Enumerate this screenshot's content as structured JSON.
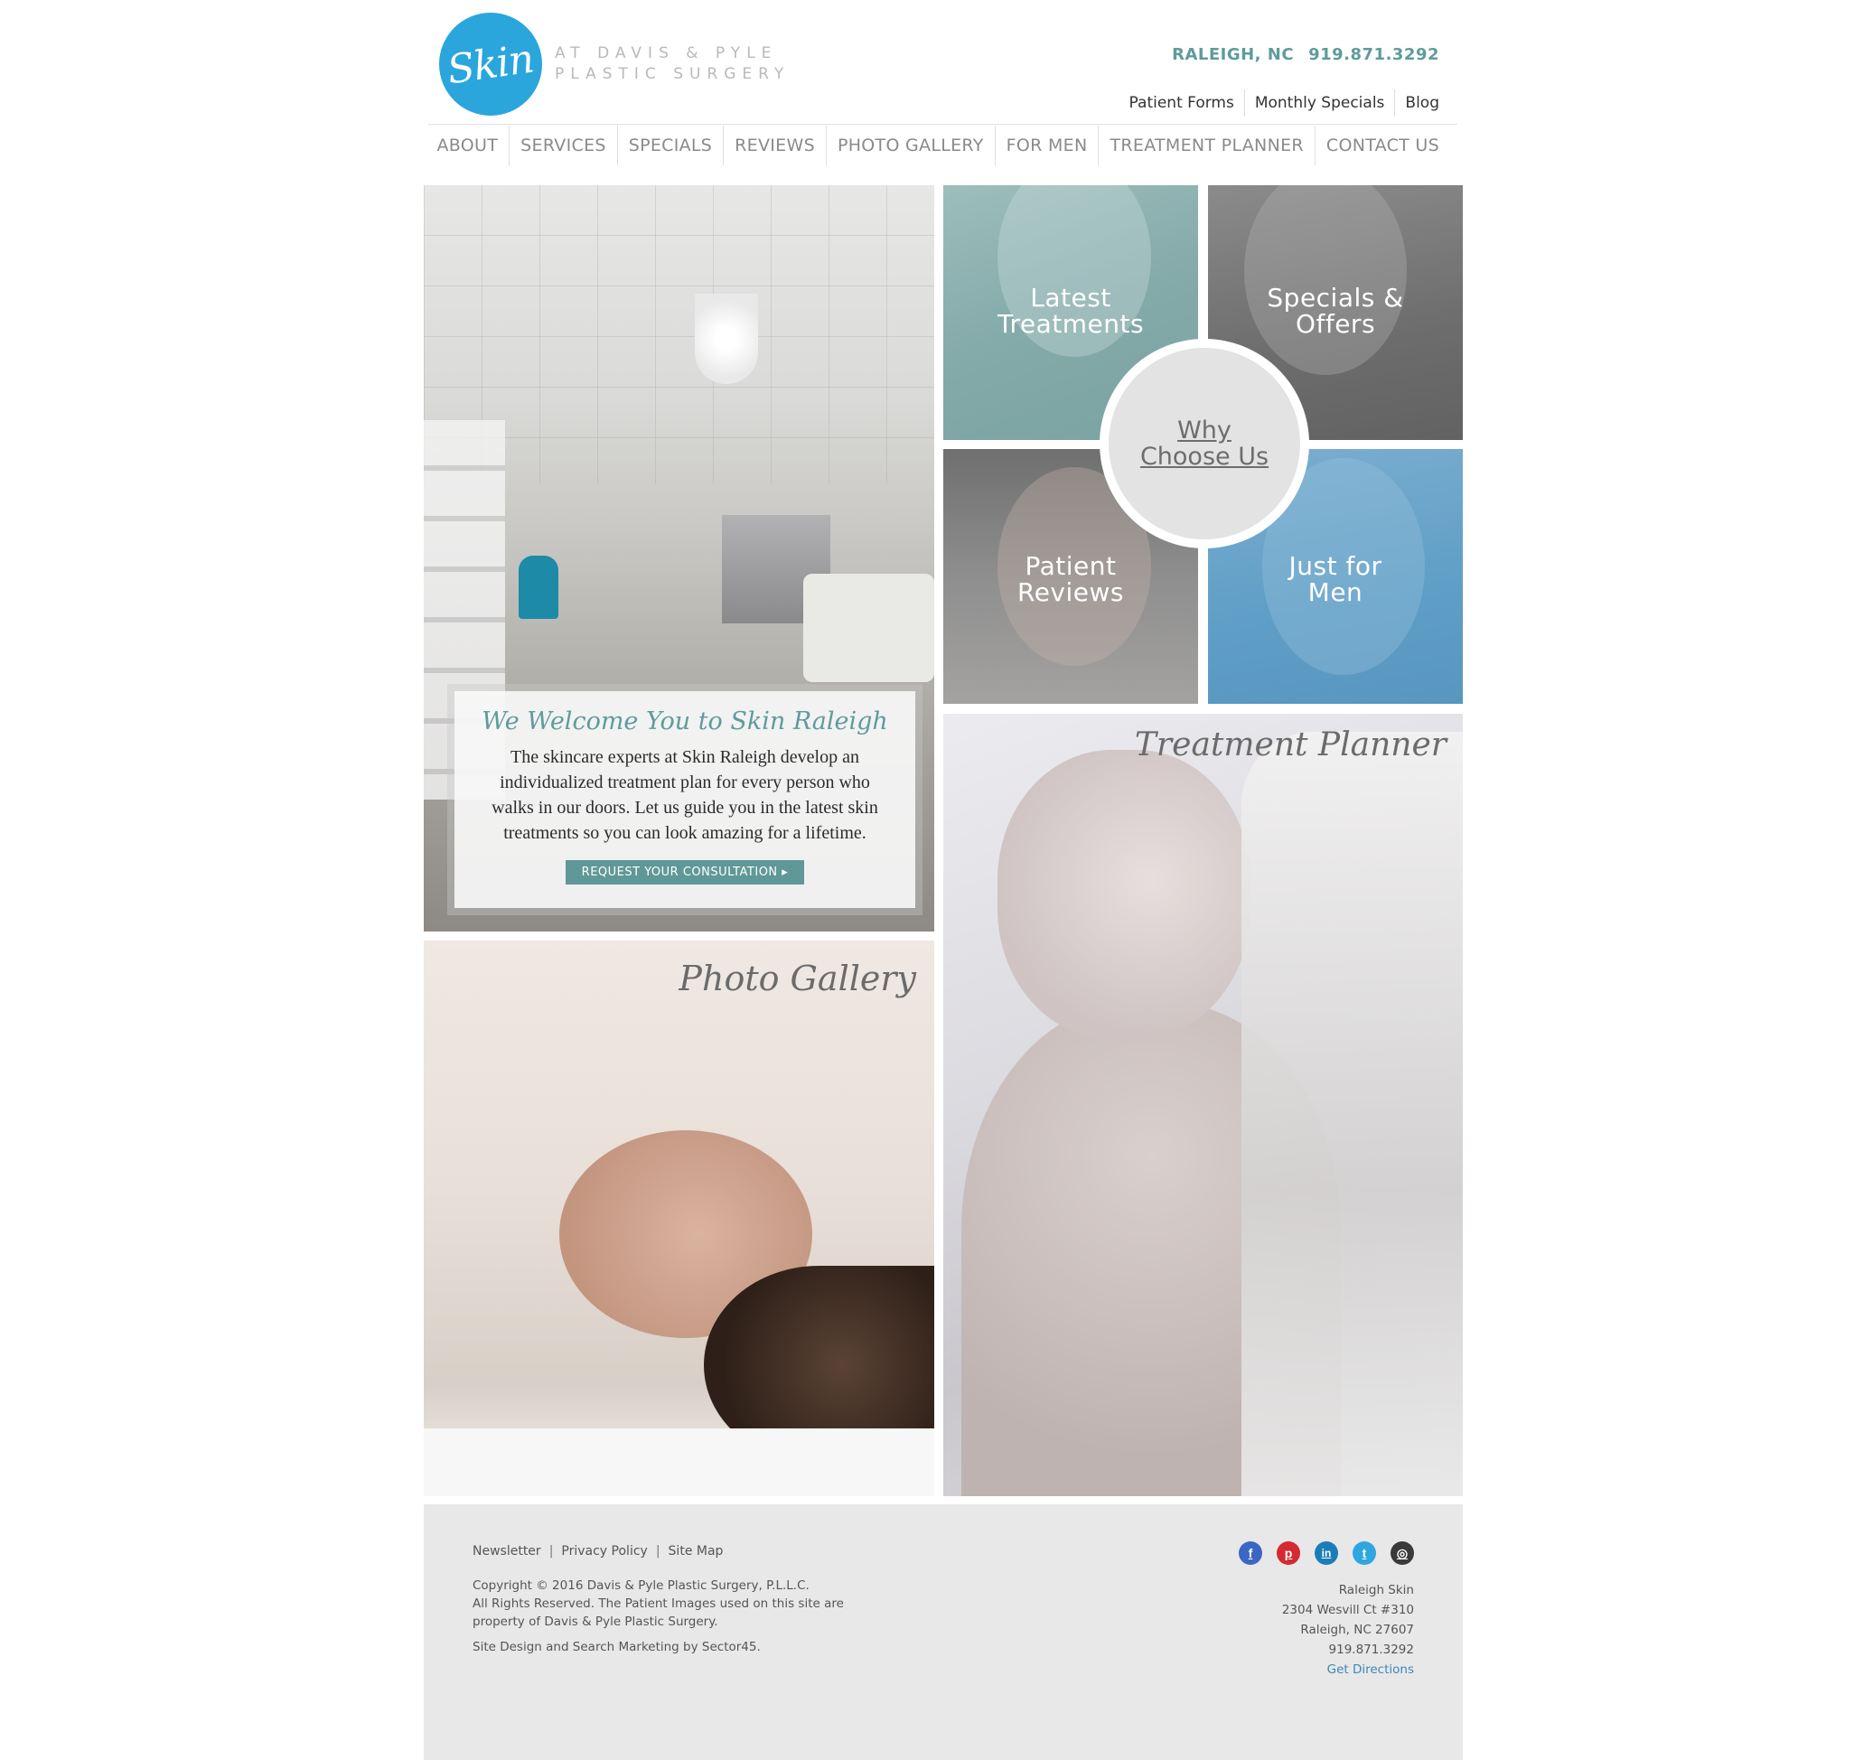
{
  "header": {
    "logo_text": "Skin",
    "logo_sub_line1": "AT DAVIS & PYLE",
    "logo_sub_line2": "PLASTIC SURGERY",
    "location": "RALEIGH, NC",
    "phone": "919.871.3292",
    "utility_nav": [
      "Patient Forms",
      "Monthly Specials",
      "Blog"
    ]
  },
  "main_nav": [
    "ABOUT",
    "SERVICES",
    "SPECIALS",
    "REVIEWS",
    "PHOTO GALLERY",
    "FOR MEN",
    "TREATMENT PLANNER",
    "CONTACT US"
  ],
  "welcome": {
    "title": "We Welcome You to Skin Raleigh",
    "text": "The skincare experts at Skin Raleigh develop an individualized treatment plan for every person who walks in our doors. Let us guide you in the latest skin treatments so you can look amazing for a lifetime.",
    "button": "REQUEST YOUR CONSULTATION"
  },
  "tiles": {
    "latest_l1": "Latest",
    "latest_l2": "Treatments",
    "specials_l1": "Specials &",
    "specials_l2": "Offers",
    "why_l1": "Why",
    "why_l2": "Choose Us",
    "reviews_l1": "Patient",
    "reviews_l2": "Reviews",
    "men_l1": "Just for",
    "men_l2": "Men",
    "planner": "Treatment Planner",
    "gallery": "Photo Gallery"
  },
  "footer": {
    "links": [
      "Newsletter",
      "Privacy Policy",
      "Site Map"
    ],
    "copyright_l1": "Copyright © 2016  Davis & Pyle Plastic Surgery, P.L.L.C.",
    "copyright_l2": "All Rights Reserved. The Patient Images used on this site are",
    "copyright_l3": "property of Davis & Pyle Plastic Surgery.",
    "credit": "Site Design and Search Marketing by Sector45.",
    "socials": [
      {
        "name": "facebook-icon",
        "glyph": "f",
        "color": "#3b66c4"
      },
      {
        "name": "pinterest-icon",
        "glyph": "p",
        "color": "#d42a33"
      },
      {
        "name": "linkedin-icon",
        "glyph": "in",
        "color": "#1b7db8"
      },
      {
        "name": "twitter-icon",
        "glyph": "t",
        "color": "#2fa6e0"
      },
      {
        "name": "instagram-icon",
        "glyph": "◎",
        "color": "#3a3a3a"
      }
    ],
    "address_name": "Raleigh Skin",
    "address_street": "2304 Wesvill Ct #310",
    "address_city": "Raleigh, NC 27607",
    "address_phone": "919.871.3292",
    "directions": "Get Directions"
  }
}
